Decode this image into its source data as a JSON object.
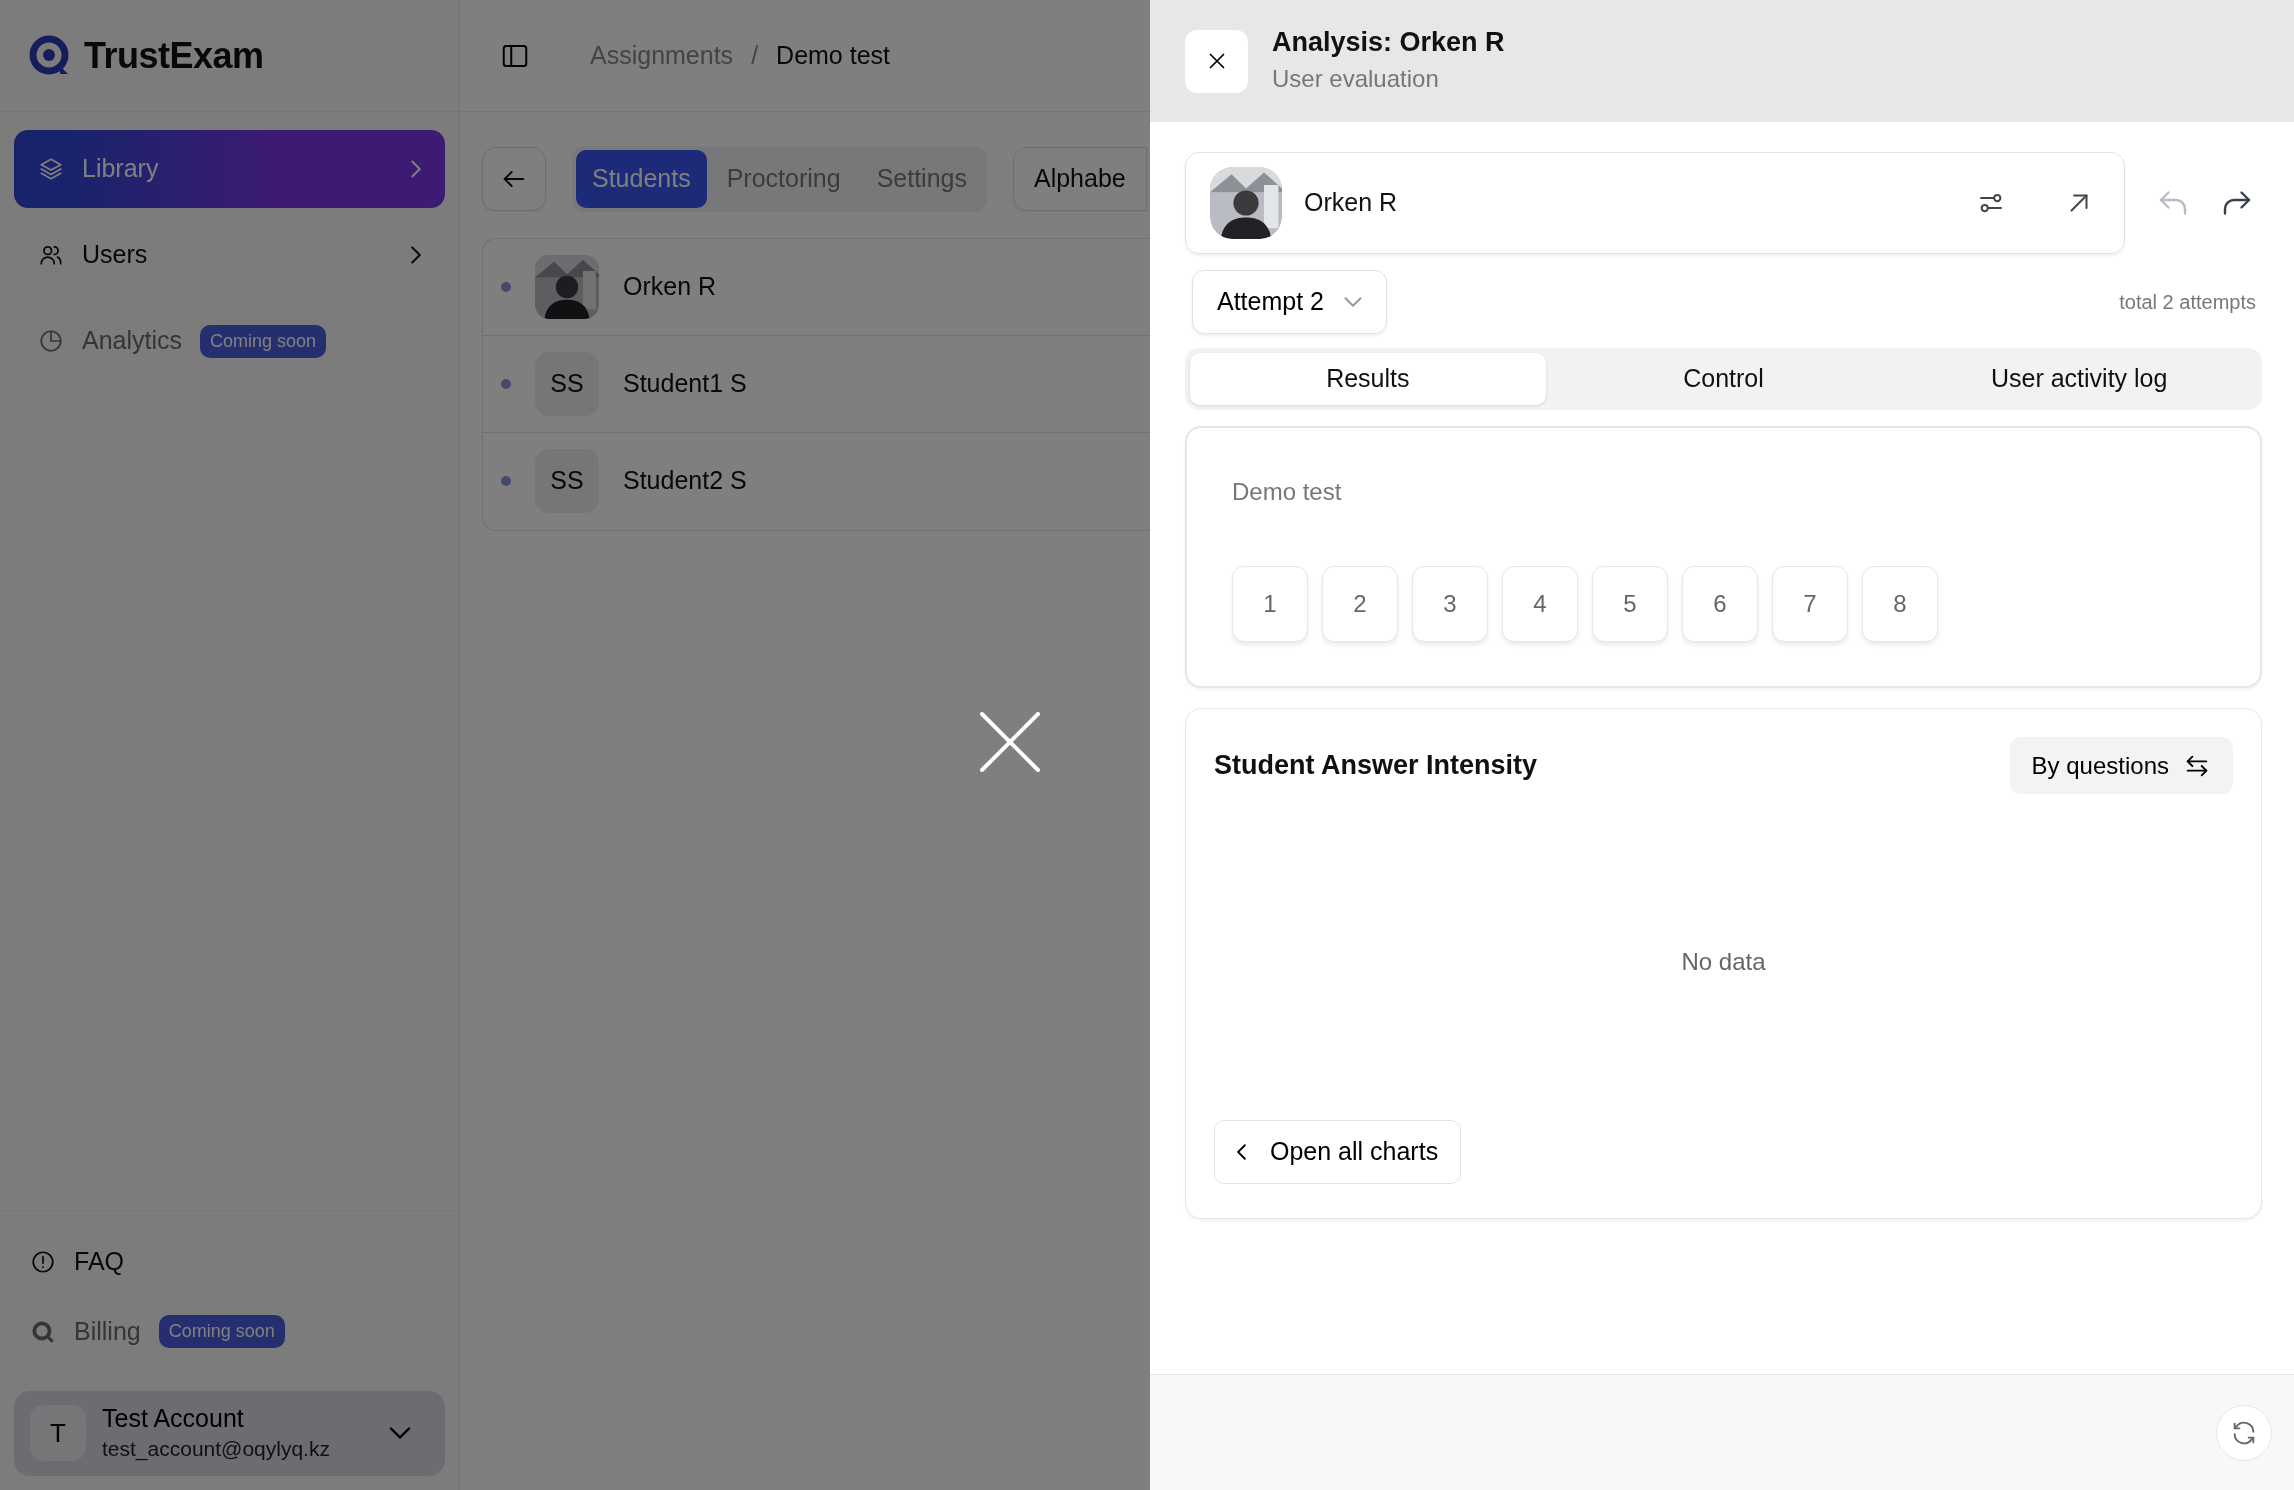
{
  "logo": "TrustExam",
  "sidebar": {
    "items": [
      {
        "label": "Library",
        "selected": true,
        "disabled": false,
        "chevron": true
      },
      {
        "label": "Users",
        "selected": false,
        "disabled": false,
        "chevron": true
      },
      {
        "label": "Analytics",
        "selected": false,
        "disabled": true,
        "badge": "Coming soon"
      }
    ],
    "bottom_items": [
      {
        "label": "FAQ",
        "disabled": false
      },
      {
        "label": "Billing",
        "disabled": true,
        "badge": "Coming soon"
      }
    ],
    "account": {
      "initial": "T",
      "name": "Test Account",
      "email": "test_account@oqylyq.kz"
    }
  },
  "breadcrumb_separator": "/",
  "breadcrumbs": [
    {
      "label": "Assignments",
      "current": false
    },
    {
      "label": "Demo test",
      "current": true
    }
  ],
  "tabs": [
    {
      "label": "Students",
      "selected": true
    },
    {
      "label": "Proctoring",
      "selected": false
    },
    {
      "label": "Settings",
      "selected": false
    }
  ],
  "sort_button": "Alphabe",
  "students": [
    {
      "name": "Orken R"
    },
    {
      "name": "Student1 S",
      "kind": "initials",
      "initials": "SS"
    },
    {
      "name": "Student2 S",
      "kind": "initials",
      "initials": "SS"
    }
  ],
  "drawer": {
    "title": "Analysis: Orken R",
    "subtitle": "User evaluation",
    "user": {
      "name": "Orken R"
    },
    "undo_disabled": true,
    "redo_disabled": false,
    "attempt": "Attempt 2",
    "total": "total 2 attempts",
    "tabs": [
      {
        "label": "Results",
        "selected": true
      },
      {
        "label": "Control",
        "selected": false
      },
      {
        "label": "User activity log",
        "selected": false
      }
    ],
    "results": {
      "title": "Demo test",
      "questions": [
        "1",
        "2",
        "3",
        "4",
        "5",
        "6",
        "7",
        "8"
      ]
    },
    "intensity": {
      "title": "Student Answer Intensity",
      "toggle": "By questions",
      "empty": "No data",
      "open_button": "Open all charts"
    }
  }
}
